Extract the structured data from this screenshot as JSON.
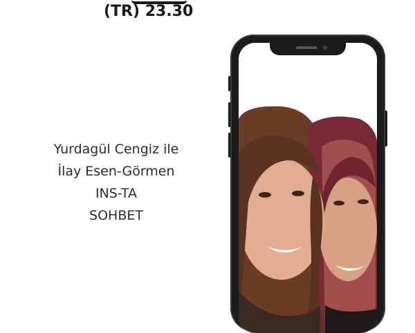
{
  "header": {
    "time_text": "(TR) 23.30"
  },
  "caption": {
    "lines": [
      "Yurdagül Cengiz ile",
      "İlay Esen-Görmen",
      "INS-TA",
      "SOHBET"
    ]
  },
  "colors": {
    "text_dark": "#1a1a1a",
    "phone_body": "#1b1b1b",
    "screen_bg": "#ffffff"
  },
  "icons": {
    "phone": "smartphone-frame",
    "photo": "portrait-photo-two-women"
  }
}
